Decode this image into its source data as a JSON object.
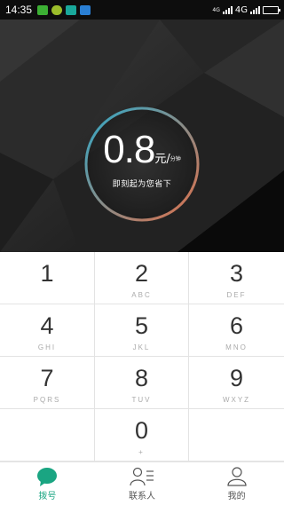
{
  "status_bar": {
    "time": "14:35",
    "network_top": "4G",
    "network": "4G",
    "notification_icons": [
      "wechat-icon",
      "chat-bubble-icon",
      "shield-icon",
      "mail-icon"
    ],
    "battery_level": 0.9
  },
  "hero": {
    "rate_value": "0.8",
    "rate_unit": "元/",
    "rate_per": "分钟",
    "tagline": "即刻起为您省下",
    "ring_colors": {
      "start": "#2fa9c8",
      "end": "#e0704a"
    }
  },
  "keypad": {
    "keys": [
      {
        "digit": "1",
        "letters": ""
      },
      {
        "digit": "2",
        "letters": "ABC"
      },
      {
        "digit": "3",
        "letters": "DEF"
      },
      {
        "digit": "4",
        "letters": "GHI"
      },
      {
        "digit": "5",
        "letters": "JKL"
      },
      {
        "digit": "6",
        "letters": "MNO"
      },
      {
        "digit": "7",
        "letters": "PQRS"
      },
      {
        "digit": "8",
        "letters": "TUV"
      },
      {
        "digit": "9",
        "letters": "WXYZ"
      },
      {
        "digit": "",
        "letters": ""
      },
      {
        "digit": "0",
        "letters": "+"
      },
      {
        "digit": "",
        "letters": ""
      }
    ]
  },
  "tabs": {
    "dial": "拨号",
    "contacts": "联系人",
    "me": "我的",
    "accent": "#1aa582"
  }
}
